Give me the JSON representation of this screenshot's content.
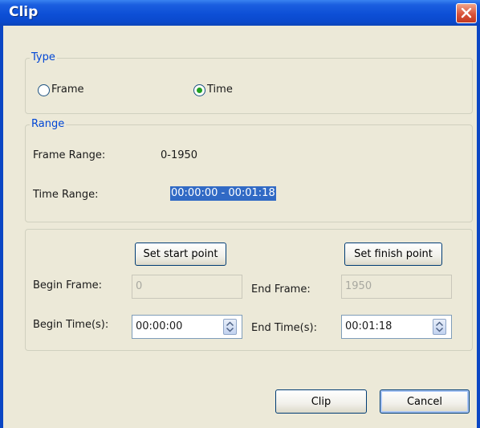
{
  "window": {
    "title": "Clip"
  },
  "type_group": {
    "legend": "Type",
    "options": [
      {
        "label": "Frame",
        "selected": false
      },
      {
        "label": "Time",
        "selected": true
      }
    ]
  },
  "range_group": {
    "legend": "Range",
    "frame_range_label": "Frame Range:",
    "frame_range_value": "0-1950",
    "time_range_label": "Time Range:",
    "time_range_value": "00:00:00 - 00:01:18"
  },
  "points_group": {
    "set_start_label": "Set start point",
    "set_finish_label": "Set finish point",
    "begin_frame_label": "Begin Frame:",
    "begin_frame_value": "0",
    "end_frame_label": "End Frame:",
    "end_frame_value": "1950",
    "begin_time_label": "Begin Time(s):",
    "begin_time_value": "00:00:00",
    "end_time_label": "End Time(s):",
    "end_time_value": "00:01:18"
  },
  "actions": {
    "clip_label": "Clip",
    "cancel_label": "Cancel"
  },
  "colors": {
    "title_bar": "#0a49cc",
    "legend": "#0046d5",
    "selection": "#316ac5",
    "face": "#ece9d8"
  }
}
